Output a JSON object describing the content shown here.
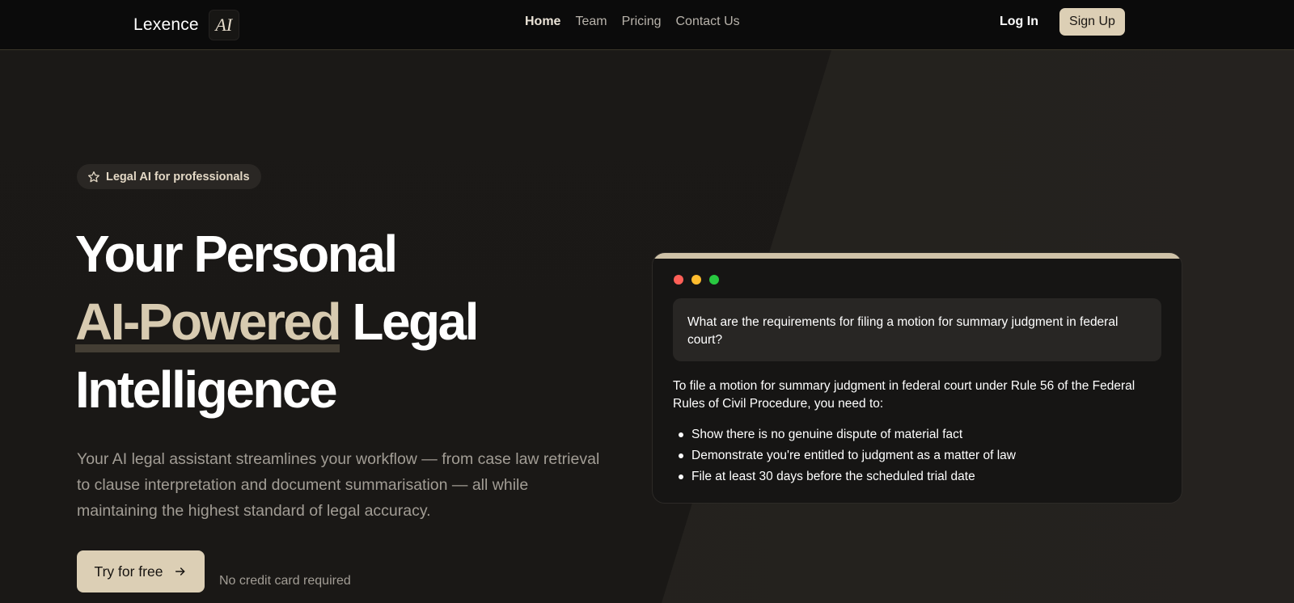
{
  "nav": {
    "brand": "Lexence",
    "logo_text": "AI",
    "links": [
      {
        "label": "Home",
        "active": true
      },
      {
        "label": "Team",
        "active": false
      },
      {
        "label": "Pricing",
        "active": false
      },
      {
        "label": "Contact Us",
        "active": false
      }
    ],
    "login": "Log In",
    "signup": "Sign Up"
  },
  "hero": {
    "badge": "Legal AI for professionals",
    "badge_icon": "star-icon",
    "headline_line1": "Your Personal",
    "headline_accent": "AI-Powered",
    "headline_line2_rest": " Legal",
    "headline_line3": "Intelligence",
    "subtext": "Your AI legal assistant streamlines your workflow — from case law retrieval to clause interpretation and document summarisation — all while maintaining the highest standard of legal accuracy.",
    "cta_label": "Try for free",
    "cta_icon": "arrow-right-icon",
    "cta_note": "No credit card required"
  },
  "chat": {
    "question": "What are the requirements for filing a motion for summary judgment in federal court?",
    "answer_intro": "To file a motion for summary judgment in federal court under Rule 56 of the Federal Rules of Civil Procedure, you need to:",
    "bullets": [
      "Show there is no genuine dispute of material fact",
      "Demonstrate you're entitled to judgment as a matter of law",
      "File at least 30 days before the scheduled trial date"
    ],
    "window_dots": [
      "#ff5f57",
      "#febc2e",
      "#28c840"
    ]
  },
  "colors": {
    "accent": "#dccfb5",
    "background": "#1a1816",
    "nav_background": "#0b0b0b"
  }
}
